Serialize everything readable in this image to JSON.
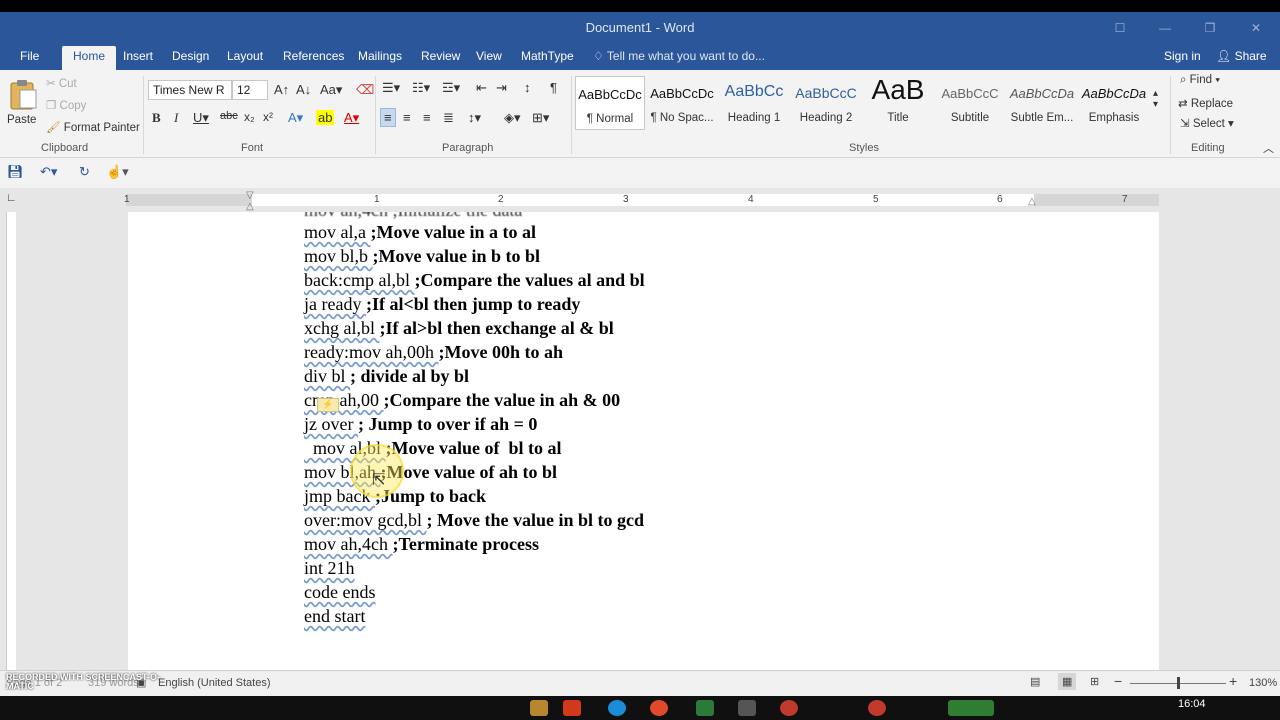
{
  "window": {
    "title": "Document1 - Word",
    "controls": [
      "☐",
      "—",
      "❐",
      "✕"
    ]
  },
  "menu": {
    "tabs": [
      "File",
      "Home",
      "Insert",
      "Design",
      "Layout",
      "References",
      "Mailings",
      "Review",
      "View",
      "MathType"
    ],
    "tell_me": "Tell me what you want to do...",
    "sign_in": "Sign in",
    "share": "Share"
  },
  "clipboard": {
    "paste": "Paste",
    "cut": "Cut",
    "copy": "Copy",
    "format_painter": "Format Painter",
    "label": "Clipboard"
  },
  "font": {
    "name": "Times New R",
    "size": "12",
    "label": "Font"
  },
  "paragraph": {
    "label": "Paragraph"
  },
  "styles": {
    "label": "Styles",
    "items": [
      {
        "sample": "AaBbCcDc",
        "name": "¶ Normal"
      },
      {
        "sample": "AaBbCcDc",
        "name": "¶ No Spac..."
      },
      {
        "sample": "AaBbCc",
        "name": "Heading 1"
      },
      {
        "sample": "AaBbCcC",
        "name": "Heading 2"
      },
      {
        "sample": "AaB",
        "name": "Title"
      },
      {
        "sample": "AaBbCcC",
        "name": "Subtitle"
      },
      {
        "sample": "AaBbCcDa",
        "name": "Subtle Em..."
      },
      {
        "sample": "AaBbCcDa",
        "name": "Emphasis"
      }
    ]
  },
  "editing": {
    "find": "Find",
    "replace": "Replace",
    "select": "Select",
    "label": "Editing"
  },
  "ruler": {
    "numbers": [
      "1",
      "1",
      "2",
      "3",
      "4",
      "5",
      "6",
      "7"
    ]
  },
  "document": {
    "lines": [
      {
        "code": "mov al,a ",
        "comment": ";Move value in a to al"
      },
      {
        "code": "mov bl,b ",
        "comment": ";Move value in b to bl"
      },
      {
        "code": "back:cmp al,bl ",
        "comment": ";Compare the values al and bl"
      },
      {
        "code": "ja ready ",
        "comment": ";If al<bl then jump to ready"
      },
      {
        "code": "xchg al,bl ",
        "comment": ";If al>bl then exchange al & bl"
      },
      {
        "code": "ready:mov ah,00h ",
        "comment": ";Move 00h to ah"
      },
      {
        "code": "div bl ",
        "comment": "; divide al by bl"
      },
      {
        "code": "cmp ah,00 ",
        "comment": ";Compare the value in ah & 00"
      },
      {
        "code": "jz over ",
        "comment": "; Jump to over if ah = 0"
      },
      {
        "code": "  mov al,bl ",
        "comment": ";Move value of  bl to al"
      },
      {
        "code": "mov bl,ah ",
        "comment": ";Move value of ah to bl"
      },
      {
        "code": "jmp back ",
        "comment": ";Jump to back"
      },
      {
        "code": "over:mov gcd,bl ",
        "comment": "; Move the value in bl to gcd"
      },
      {
        "code": "mov ah,4ch ",
        "comment": ";Terminate process"
      },
      {
        "code": "int 21h",
        "comment": ""
      },
      {
        "code": "code ends",
        "comment": ""
      },
      {
        "code": "end start",
        "comment": ""
      }
    ]
  },
  "status": {
    "page": "Page 1 of 2",
    "words": "319 words",
    "language": "English (United States)",
    "zoom": "130%",
    "watermark": "RECORDED WITH SCREENCAST-O-MATIC",
    "time": "16:04"
  }
}
